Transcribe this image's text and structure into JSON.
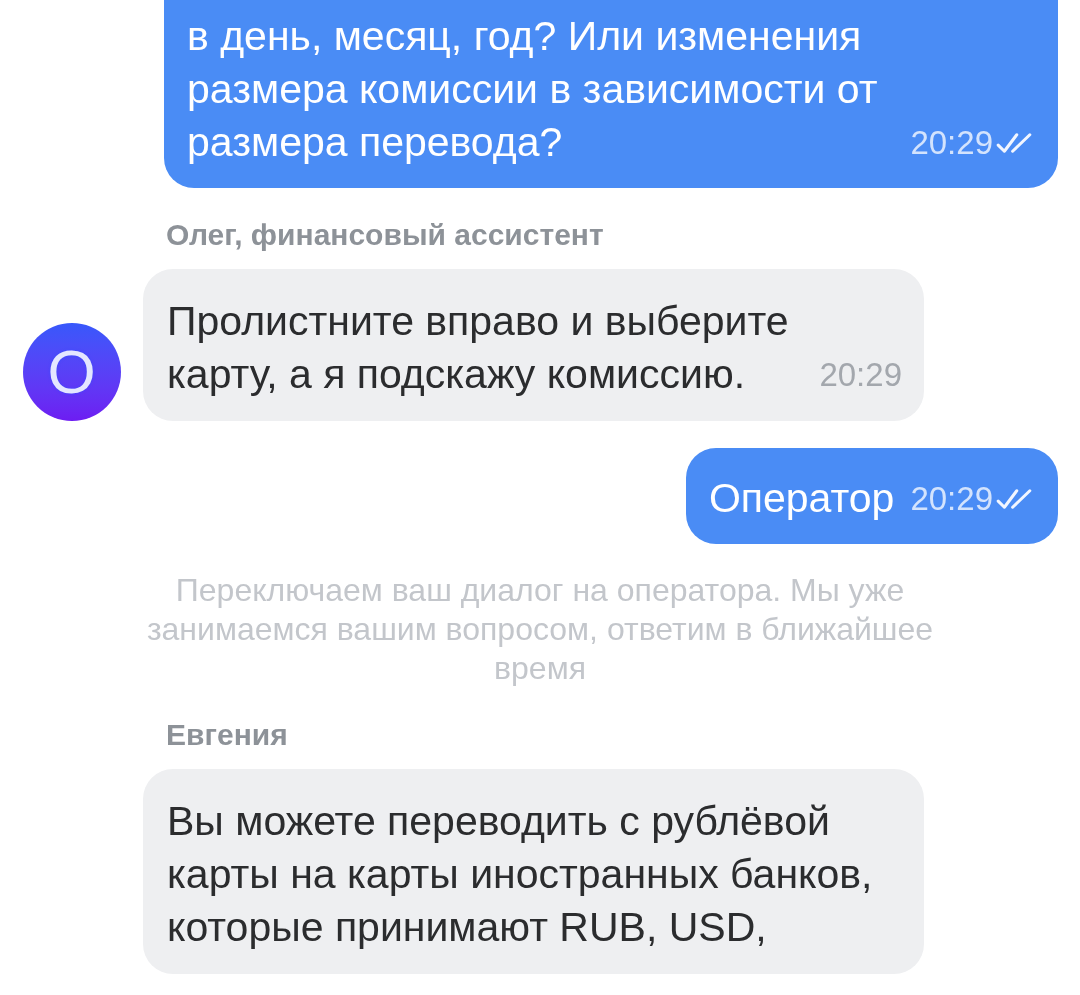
{
  "messages": [
    {
      "kind": "outgoing",
      "text": "в день, месяц, год? Или изменения размера комиссии в зависимости от размера перевода?",
      "time": "20:29",
      "read": true
    },
    {
      "kind": "incoming",
      "sender": "Олег, финансовый ассистент",
      "avatar": "О",
      "text": "Пролистните вправо и выберите карту, а я подскажу комиссию.",
      "time": "20:29"
    },
    {
      "kind": "outgoing",
      "text": "Оператор",
      "time": "20:29",
      "read": true
    },
    {
      "kind": "system",
      "text": "Переключаем ваш диалог на оператора. Мы уже занимаемся вашим вопросом, ответим в ближайшее время"
    },
    {
      "kind": "incoming",
      "sender": "Евгения",
      "text": "Вы можете переводить с рублёвой карты на карты иностранных банков, которые принимают RUB, USD,"
    }
  ]
}
